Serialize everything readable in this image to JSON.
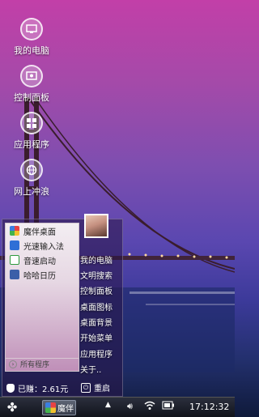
{
  "desktop": {
    "icons": [
      {
        "label": "我的电脑",
        "icon": "computer-icon"
      },
      {
        "label": "控制面板",
        "icon": "control-panel-icon"
      },
      {
        "label": "应用程序",
        "icon": "apps-icon"
      },
      {
        "label": "网上冲浪",
        "icon": "globe-icon"
      }
    ]
  },
  "start_menu": {
    "apps": [
      {
        "label": "魔伴桌面",
        "icon": "mobanzhuomian-icon",
        "color": "#e45a3c"
      },
      {
        "label": "光速输入法",
        "icon": "input-method-icon",
        "color": "#2f6fd6"
      },
      {
        "label": "音速启动",
        "icon": "vstart-icon",
        "color": "#2e9a3e"
      },
      {
        "label": "哈哈日历",
        "icon": "calendar-icon",
        "color": "#3b5fa8"
      }
    ],
    "all_programs": "所有程序",
    "right_items": [
      "我的电脑",
      "文明搜索",
      "控制面板",
      "桌面图标",
      "桌面背景",
      "开始菜单",
      "应用程序",
      "关于.."
    ],
    "earned": "已赚：2.61元",
    "restart": "重启"
  },
  "taskbar": {
    "task_label": "魔伴",
    "clock": "17:12:32"
  }
}
